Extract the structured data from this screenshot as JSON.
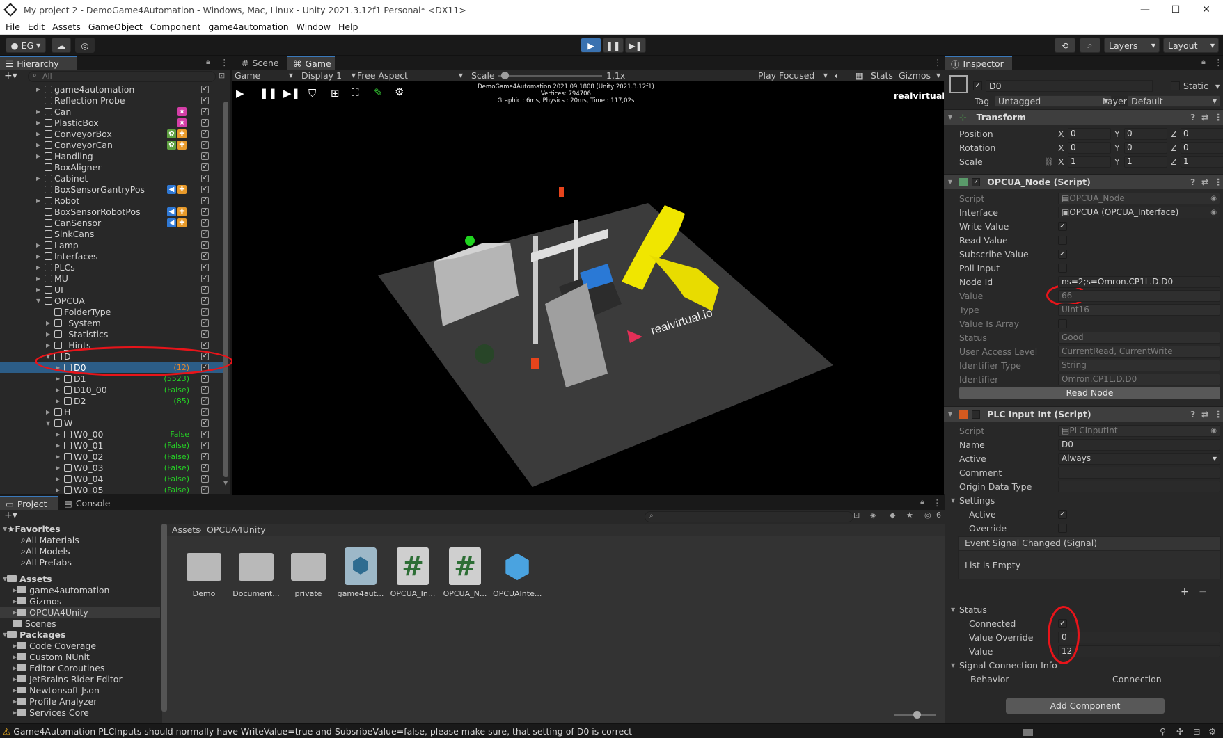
{
  "window": {
    "title": "My project 2 - DemoGame4Automation - Windows, Mac, Linux - Unity 2021.3.12f1 Personal* <DX11>"
  },
  "menu": [
    "File",
    "Edit",
    "Assets",
    "GameObject",
    "Component",
    "game4automation",
    "Window",
    "Help"
  ],
  "toolbar": {
    "account": "EG",
    "layers": "Layers",
    "layout": "Layout"
  },
  "hierarchy": {
    "tab": "Hierarchy",
    "search_placeholder": "All",
    "rows": [
      {
        "name": "game4automation",
        "depth": 0,
        "tri": true
      },
      {
        "name": "Reflection Probe",
        "depth": 0,
        "tri": false
      },
      {
        "name": "Can",
        "depth": 0,
        "tri": true
      },
      {
        "name": "PlasticBox",
        "depth": 0,
        "tri": true
      },
      {
        "name": "ConveyorBox",
        "depth": 0,
        "tri": true
      },
      {
        "name": "ConveyorCan",
        "depth": 0,
        "tri": true
      },
      {
        "name": "Handling",
        "depth": 0,
        "tri": true
      },
      {
        "name": "BoxAligner",
        "depth": 0,
        "tri": false
      },
      {
        "name": "Cabinet",
        "depth": 0,
        "tri": true
      },
      {
        "name": "BoxSensorGantryPos",
        "depth": 0,
        "tri": false
      },
      {
        "name": "Robot",
        "depth": 0,
        "tri": true
      },
      {
        "name": "BoxSensorRobotPos",
        "depth": 0,
        "tri": false
      },
      {
        "name": "CanSensor",
        "depth": 0,
        "tri": false
      },
      {
        "name": "SinkCans",
        "depth": 0,
        "tri": false
      },
      {
        "name": "Lamp",
        "depth": 0,
        "tri": true
      },
      {
        "name": "Interfaces",
        "depth": 0,
        "tri": true
      },
      {
        "name": "PLCs",
        "depth": 0,
        "tri": true
      },
      {
        "name": "MU",
        "depth": 0,
        "tri": true
      },
      {
        "name": "UI",
        "depth": 0,
        "tri": true
      },
      {
        "name": "OPCUA",
        "depth": 0,
        "tri": true,
        "open": true
      },
      {
        "name": "FolderType",
        "depth": 1,
        "tri": false
      },
      {
        "name": "_System",
        "depth": 1,
        "tri": true
      },
      {
        "name": "_Statistics",
        "depth": 1,
        "tri": true
      },
      {
        "name": "_Hints",
        "depth": 1,
        "tri": true
      },
      {
        "name": "D",
        "depth": 1,
        "tri": true,
        "open": true
      },
      {
        "name": "D0",
        "depth": 2,
        "tri": true,
        "value": "(12)",
        "vclass": "o",
        "selected": true
      },
      {
        "name": "D1",
        "depth": 2,
        "tri": true,
        "value": "(5523)",
        "vclass": "g"
      },
      {
        "name": "D10_00",
        "depth": 2,
        "tri": true,
        "value": "(False)",
        "vclass": "g"
      },
      {
        "name": "D2",
        "depth": 2,
        "tri": true,
        "value": "(85)",
        "vclass": "g"
      },
      {
        "name": "H",
        "depth": 1,
        "tri": true
      },
      {
        "name": "W",
        "depth": 1,
        "tri": true,
        "open": true
      },
      {
        "name": "W0_00",
        "depth": 2,
        "tri": true,
        "value": "False",
        "vclass": "g"
      },
      {
        "name": "W0_01",
        "depth": 2,
        "tri": true,
        "value": "(False)",
        "vclass": "g"
      },
      {
        "name": "W0_02",
        "depth": 2,
        "tri": true,
        "value": "(False)",
        "vclass": "g"
      },
      {
        "name": "W0_03",
        "depth": 2,
        "tri": true,
        "value": "(False)",
        "vclass": "g"
      },
      {
        "name": "W0_04",
        "depth": 2,
        "tri": true,
        "value": "(False)",
        "vclass": "g"
      },
      {
        "name": "W0_05",
        "depth": 2,
        "tri": true,
        "value": "(False)",
        "vclass": "g"
      }
    ]
  },
  "scene_tabs": {
    "scene": "Scene",
    "game": "Game"
  },
  "game_toolbar": {
    "game": "Game",
    "display": "Display 1",
    "aspect": "Free Aspect",
    "scale_label": "Scale",
    "scale_value": "1.1x",
    "play_focused": "Play Focused",
    "stats": "Stats",
    "gizmos": "Gizmos"
  },
  "game_overlay": {
    "line1": "DemoGame4Automation 2021.09.1808 (Unity 2021.3.12f1)",
    "line2": "Vertices: 794706",
    "line3": "Graphic : 6ms, Physics : 20ms, Time : 117,02s",
    "brand_tr": "realvirtual.io",
    "brand_floor": "realvirtual.io"
  },
  "inspector": {
    "tab": "Inspector",
    "object_name": "D0",
    "static_label": "Static",
    "tag_label": "Tag",
    "tag_value": "Untagged",
    "layer_label": "Layer",
    "layer_value": "Default",
    "transform": {
      "title": "Transform",
      "position_label": "Position",
      "rotation_label": "Rotation",
      "scale_label": "Scale",
      "position": [
        "0",
        "0",
        "0"
      ],
      "rotation": [
        "0",
        "0",
        "0"
      ],
      "scale": [
        "1",
        "1",
        "1"
      ]
    },
    "opcua": {
      "title": "OPCUA_Node (Script)",
      "rows": [
        {
          "label": "Script",
          "value": "OPCUA_Node",
          "type": "field",
          "dim": true
        },
        {
          "label": "Interface",
          "value": "OPCUA (OPCUA_Interface)",
          "type": "field"
        },
        {
          "label": "Write Value",
          "type": "check",
          "checked": true
        },
        {
          "label": "Read Value",
          "type": "check",
          "checked": false
        },
        {
          "label": "Subscribe Value",
          "type": "check",
          "checked": true
        },
        {
          "label": "Poll Input",
          "type": "check",
          "checked": false
        },
        {
          "label": "Node Id",
          "value": "ns=2;s=Omron.CP1L.D.D0",
          "type": "field"
        },
        {
          "label": "Value",
          "value": "66",
          "type": "field",
          "dim": true
        },
        {
          "label": "Type",
          "value": "UInt16",
          "type": "field",
          "dim": true
        },
        {
          "label": "Value Is Array",
          "type": "check",
          "checked": false,
          "dim": true
        },
        {
          "label": "Status",
          "value": "Good",
          "type": "field",
          "dim": true
        },
        {
          "label": "User Access Level",
          "value": "CurrentRead, CurrentWrite",
          "type": "field",
          "dim": true
        },
        {
          "label": "Identifier Type",
          "value": "String",
          "type": "field",
          "dim": true
        },
        {
          "label": "Identifier",
          "value": "Omron.CP1L.D.D0",
          "type": "field",
          "dim": true
        }
      ],
      "read_node_button": "Read Node"
    },
    "plc": {
      "title": "PLC Input Int (Script)",
      "rows": [
        {
          "label": "Script",
          "value": "PLCInputInt",
          "type": "field",
          "dim": true
        },
        {
          "label": "Name",
          "value": "D0",
          "type": "field"
        },
        {
          "label": "Active",
          "value": "Always",
          "type": "field"
        },
        {
          "label": "Comment",
          "value": "",
          "type": "field"
        },
        {
          "label": "Origin Data Type",
          "value": "",
          "type": "field"
        }
      ],
      "settings_label": "Settings",
      "settings_active": "Active",
      "settings_override": "Override",
      "event_label": "Event Signal Changed (Signal)",
      "list_empty": "List is Empty",
      "status_label": "Status",
      "connected_label": "Connected",
      "value_override_label": "Value Override",
      "value_override": "0",
      "value_label": "Value",
      "value": "12",
      "signal_conn_label": "Signal Connection Info",
      "behavior_label": "Behavior",
      "connection_label": "Connection"
    },
    "add_component": "Add Component"
  },
  "project": {
    "tab_project": "Project",
    "tab_console": "Console",
    "favorites": "Favorites",
    "fav_items": [
      "All Materials",
      "All Models",
      "All Prefabs"
    ],
    "assets": "Assets",
    "asset_items": [
      "game4automation",
      "Gizmos",
      "OPCUA4Unity",
      "Scenes"
    ],
    "packages": "Packages",
    "package_items": [
      "Code Coverage",
      "Custom NUnit",
      "Editor Coroutines",
      "JetBrains Rider Editor",
      "Newtonsoft Json",
      "Profile Analyzer",
      "Services Core"
    ],
    "breadcrumb_root": "Assets",
    "breadcrumb_leaf": "OPCUA4Unity",
    "files": [
      "Demo",
      "Document...",
      "private",
      "game4aut...",
      "OPCUA_In...",
      "OPCUA_N...",
      "OPCUAInte..."
    ],
    "hidden_count": "6"
  },
  "statusbar": {
    "message": "Game4Automation PLCInputs should normally have WriteValue=true and SubsribeValue=false, please make sure, that  setting of D0 is correct"
  }
}
